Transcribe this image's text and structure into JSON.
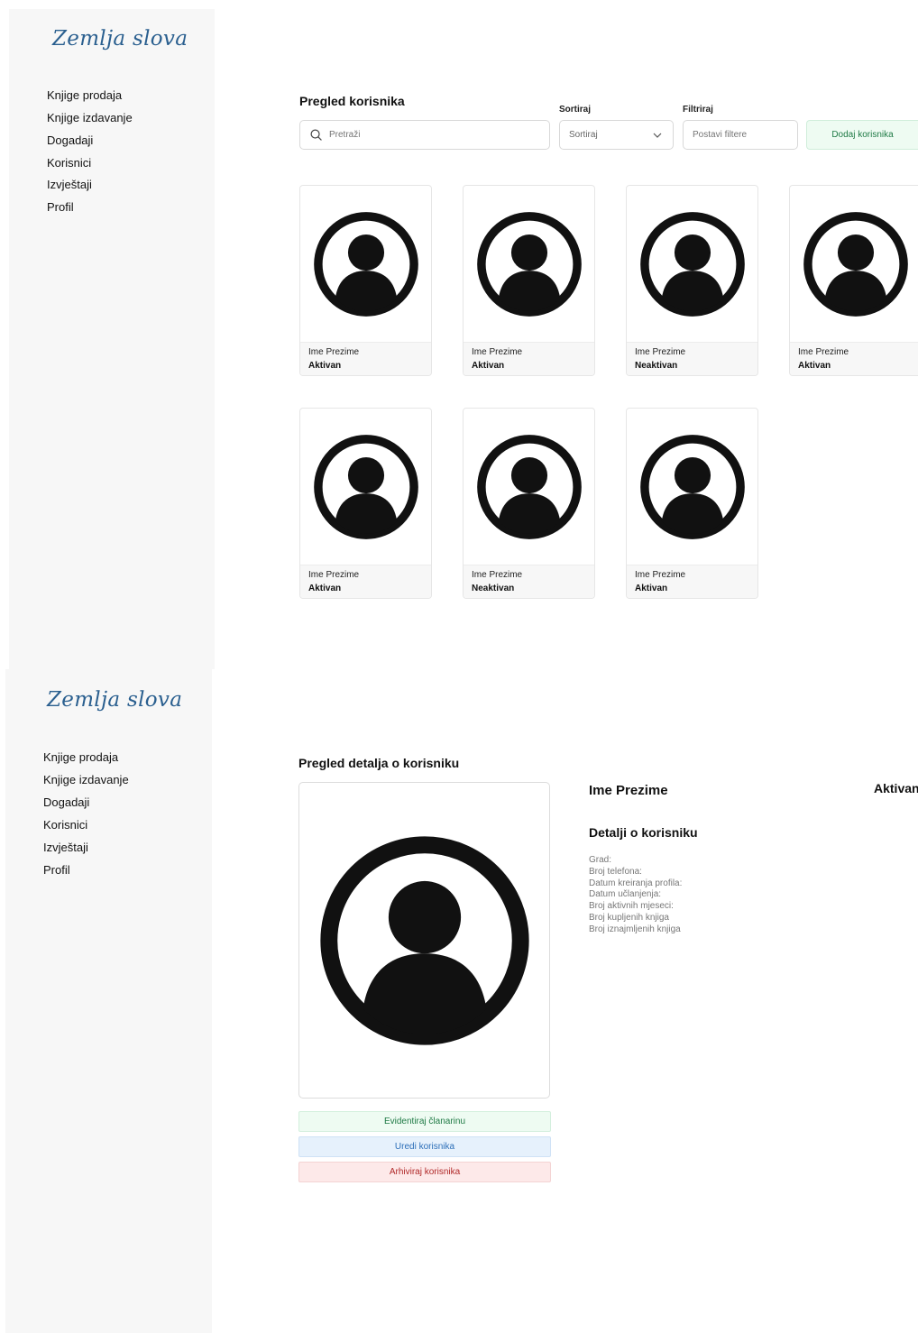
{
  "brand": {
    "name": "Zemlja slova"
  },
  "sidebar": {
    "items": [
      {
        "label": "Knjige prodaja"
      },
      {
        "label": "Knjige izdavanje"
      },
      {
        "label": "Dogadaji"
      },
      {
        "label": "Korisnici"
      },
      {
        "label": "Izvještaji"
      },
      {
        "label": "Profil"
      }
    ]
  },
  "overview": {
    "title": "Pregled korisnika",
    "search": {
      "placeholder": "Pretraži",
      "value": ""
    },
    "sort": {
      "label": "Sortiraj",
      "selected": "Sortiraj"
    },
    "filter": {
      "label": "Filtriraj",
      "placeholder": "Postavi filtere"
    },
    "add_button": "Dodaj korisnika",
    "users": [
      {
        "name": "Ime Prezime",
        "status": "Aktivan"
      },
      {
        "name": "Ime Prezime",
        "status": "Aktivan"
      },
      {
        "name": "Ime Prezime",
        "status": "Neaktivan"
      },
      {
        "name": "Ime Prezime",
        "status": "Aktivan"
      },
      {
        "name": "Ime Prezime",
        "status": "Aktivan"
      },
      {
        "name": "Ime Prezime",
        "status": "Neaktivan"
      },
      {
        "name": "Ime Prezime",
        "status": "Aktivan"
      }
    ]
  },
  "details": {
    "title": "Pregled detalja o korisniku",
    "name": "Ime Prezime",
    "status": "Aktivan",
    "section_title": "Detalji o korisniku",
    "fields": [
      "Grad:",
      "Broj telefona:",
      "Datum kreiranja profila:",
      "Datum učlanjenja:",
      "Broj aktivnih mjeseci:",
      "Broj kupljenih knjiga",
      "Broj iznajmljenih knjiga"
    ],
    "buttons": {
      "membership": "Evidentiraj članarinu",
      "edit": "Uredi korisnika",
      "archive": "Arhiviraj korisnika"
    }
  },
  "colors": {
    "sidebar_bg": "#f7f7f7",
    "logo": "#2a5f8f",
    "success": "#1f7a45",
    "info": "#2d6fb8",
    "danger": "#b02828"
  }
}
